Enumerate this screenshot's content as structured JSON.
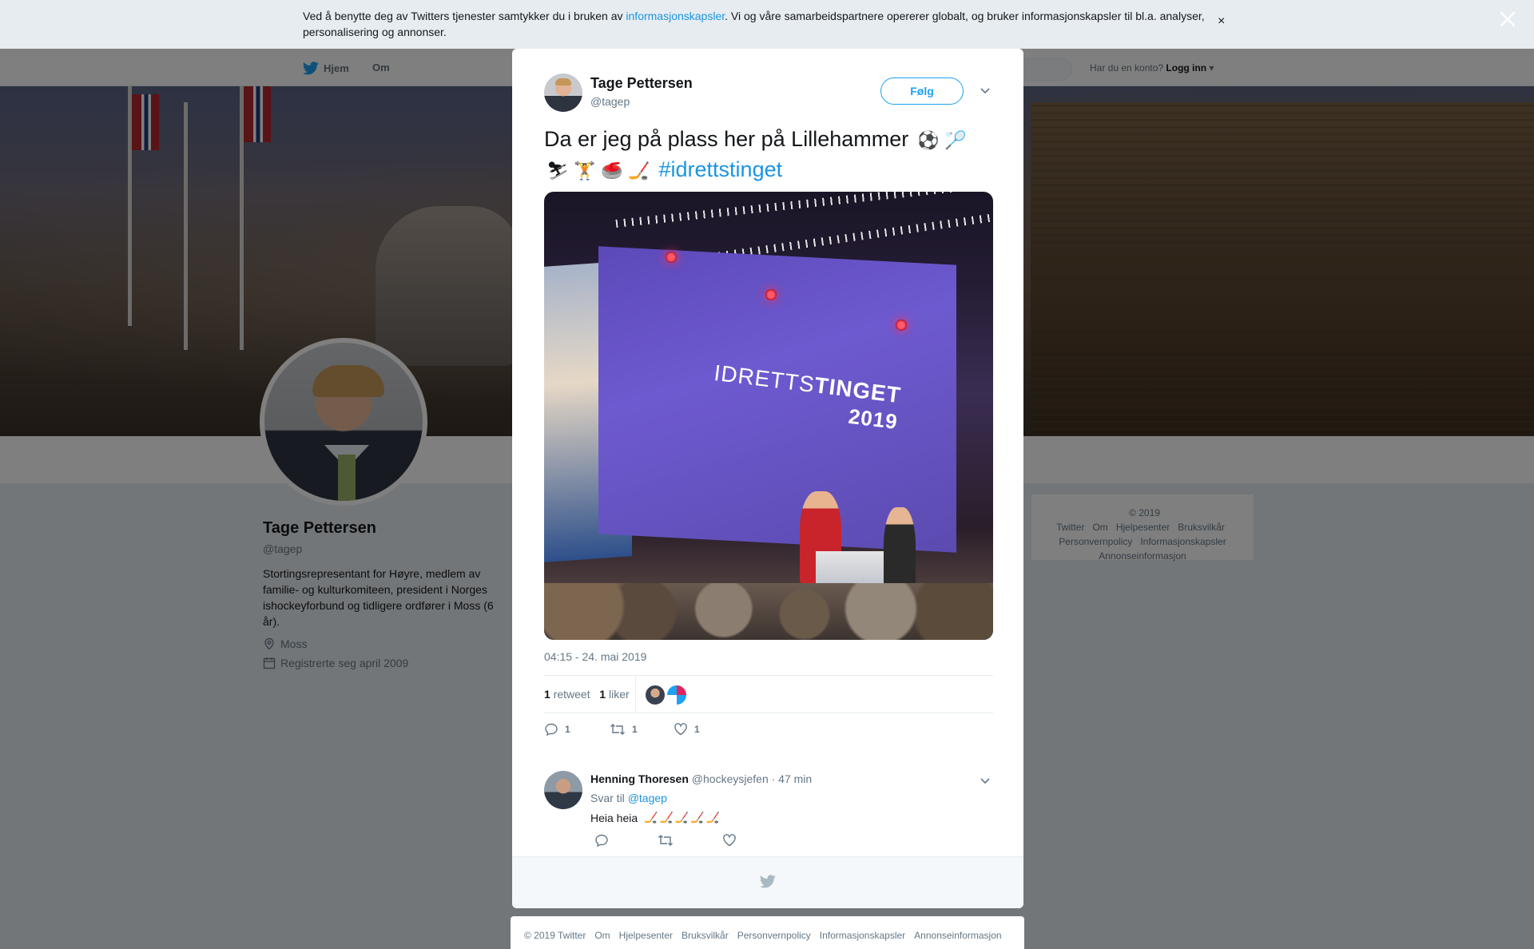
{
  "cookie": {
    "text_before": "Ved å benytte deg av Twitters tjenester samtykker du i bruken av ",
    "link": "informasjonskapsler",
    "text_after": ". Vi og våre samarbeidspartnere opererer globalt, og bruker informasjonskapsler til bl.a. analyser, personalisering og annonser.",
    "close": "×"
  },
  "nav": {
    "home": "Hjem",
    "about": "Om",
    "login_prompt": "Har du en konto?",
    "login": "Logg inn"
  },
  "profile": {
    "name": "Tage Pettersen",
    "handle": "@tagep",
    "bio": "Stortingsrepresentant for Høyre, medlem av familie- og kulturkomiteen, president i Norges ishockeyforbund og tidligere ordfører i Moss (6 år).",
    "location": "Moss",
    "joined": "Registrerte seg april 2009"
  },
  "side_footer": {
    "links": [
      "© 2019 Twitter",
      "Om",
      "Hjelpesenter",
      "Bruksvilkår",
      "Personvernpolicy",
      "Informasjonskapsler",
      "Annonseinformasjon"
    ]
  },
  "tweet": {
    "author_name": "Tage Pettersen",
    "author_handle": "@tagep",
    "follow_label": "Følg",
    "text": "Da er jeg på plass her på Lillehammer",
    "emojis_line1": [
      "⚽",
      "🏸"
    ],
    "emojis_line2": [
      "⛷",
      "🏋",
      "🥌",
      "🏒"
    ],
    "hashtag": "#idrettstinget",
    "photo_text_a": "IDRETTS",
    "photo_text_b": "TINGET",
    "photo_year": "2019",
    "timestamp": "04:15 - 24. mai 2019",
    "retweets_count": "1",
    "retweets_label": "retweet",
    "likes_count": "1",
    "likes_label": "liker",
    "reply_count": "1",
    "retweet_action_count": "1",
    "like_action_count": "1"
  },
  "reply": {
    "name": "Henning Thoresen",
    "handle": "@hockeysjefen",
    "time": "· 47 min",
    "reply_to_label": "Svar til",
    "reply_to_handle": "@tagep",
    "text": "Heia heia",
    "emojis": [
      "🏒",
      "🏒",
      "🏒",
      "🏒",
      "🏒"
    ]
  },
  "bottom_footer": {
    "links": [
      "© 2019 Twitter",
      "Om",
      "Hjelpesenter",
      "Bruksvilkår",
      "Personvernpolicy",
      "Informasjonskapsler",
      "Annonseinformasjon"
    ]
  },
  "colors": {
    "accent": "#1da1f2",
    "link": "#1b95e0",
    "muted": "#657786"
  }
}
